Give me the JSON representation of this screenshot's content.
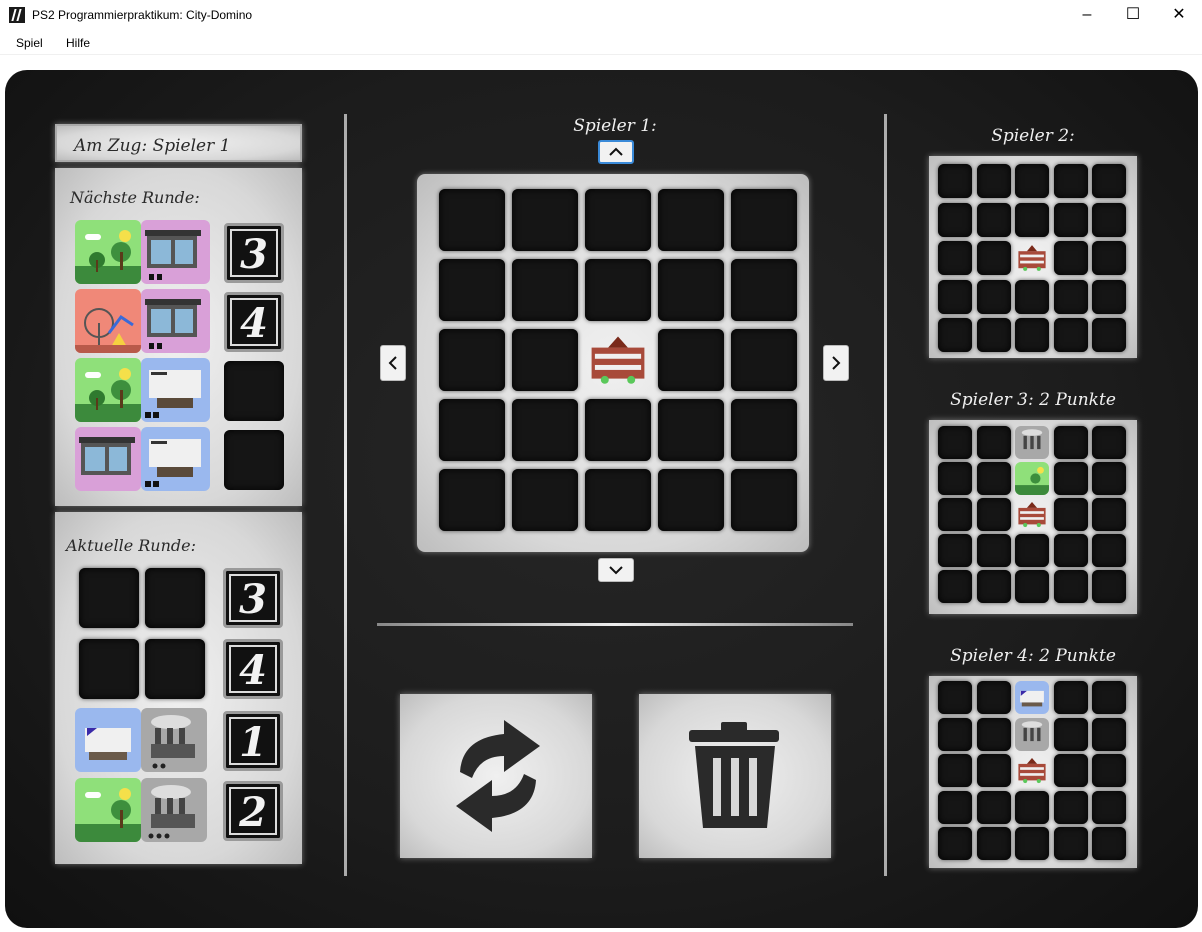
{
  "window": {
    "title": "PS2 Programmierpraktikum: City-Domino",
    "minimize": "–",
    "maximize": "☐",
    "close": "✕"
  },
  "menu": {
    "items": [
      "Spiel",
      "Hilfe"
    ]
  },
  "left_panel": {
    "turn_label": "Am Zug: Spieler 1",
    "next_round": {
      "title": "Nächste Runde:",
      "numbers": [
        "3",
        "4",
        "",
        ""
      ]
    },
    "current_round": {
      "title": "Aktuelle Runde:",
      "numbers": [
        "3",
        "4",
        "1",
        "2"
      ]
    }
  },
  "center": {
    "player_label": "Spieler 1:"
  },
  "right_panel": {
    "player2_label": "Spieler 2:",
    "player3_label": "Spieler 3: 2 Punkte",
    "player4_label": "Spieler 4: 2 Punkte"
  },
  "icons": {
    "rotate": "rotate-icon",
    "trash": "trash-icon"
  },
  "colors": {
    "park": "#8fe07a",
    "shop": "#d9a0d8",
    "amusement": "#f08878",
    "office": "#9ab8ee",
    "industry": "#a8a8a8",
    "board": "#1c1c1c"
  }
}
